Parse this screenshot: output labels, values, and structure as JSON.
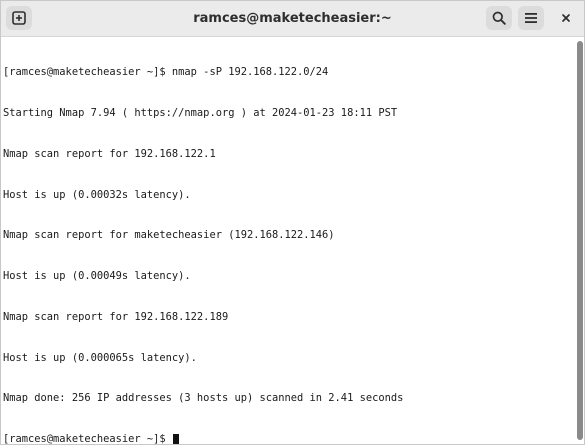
{
  "window": {
    "title": "ramces@maketecheasier:~"
  },
  "toolbar": {
    "new_tab_icon": "new-tab-plus-icon",
    "search_icon": "search-icon",
    "menu_icon": "hamburger-menu-icon",
    "close_icon": "close-icon"
  },
  "terminal": {
    "lines": [
      "[ramces@maketecheasier ~]$ nmap -sP 192.168.122.0/24",
      "Starting Nmap 7.94 ( https://nmap.org ) at 2024-01-23 18:11 PST",
      "Nmap scan report for 192.168.122.1",
      "Host is up (0.00032s latency).",
      "Nmap scan report for maketecheasier (192.168.122.146)",
      "Host is up (0.00049s latency).",
      "Nmap scan report for 192.168.122.189",
      "Host is up (0.000065s latency).",
      "Nmap done: 256 IP addresses (3 hosts up) scanned in 2.41 seconds"
    ],
    "prompt": "[ramces@maketecheasier ~]$ "
  }
}
